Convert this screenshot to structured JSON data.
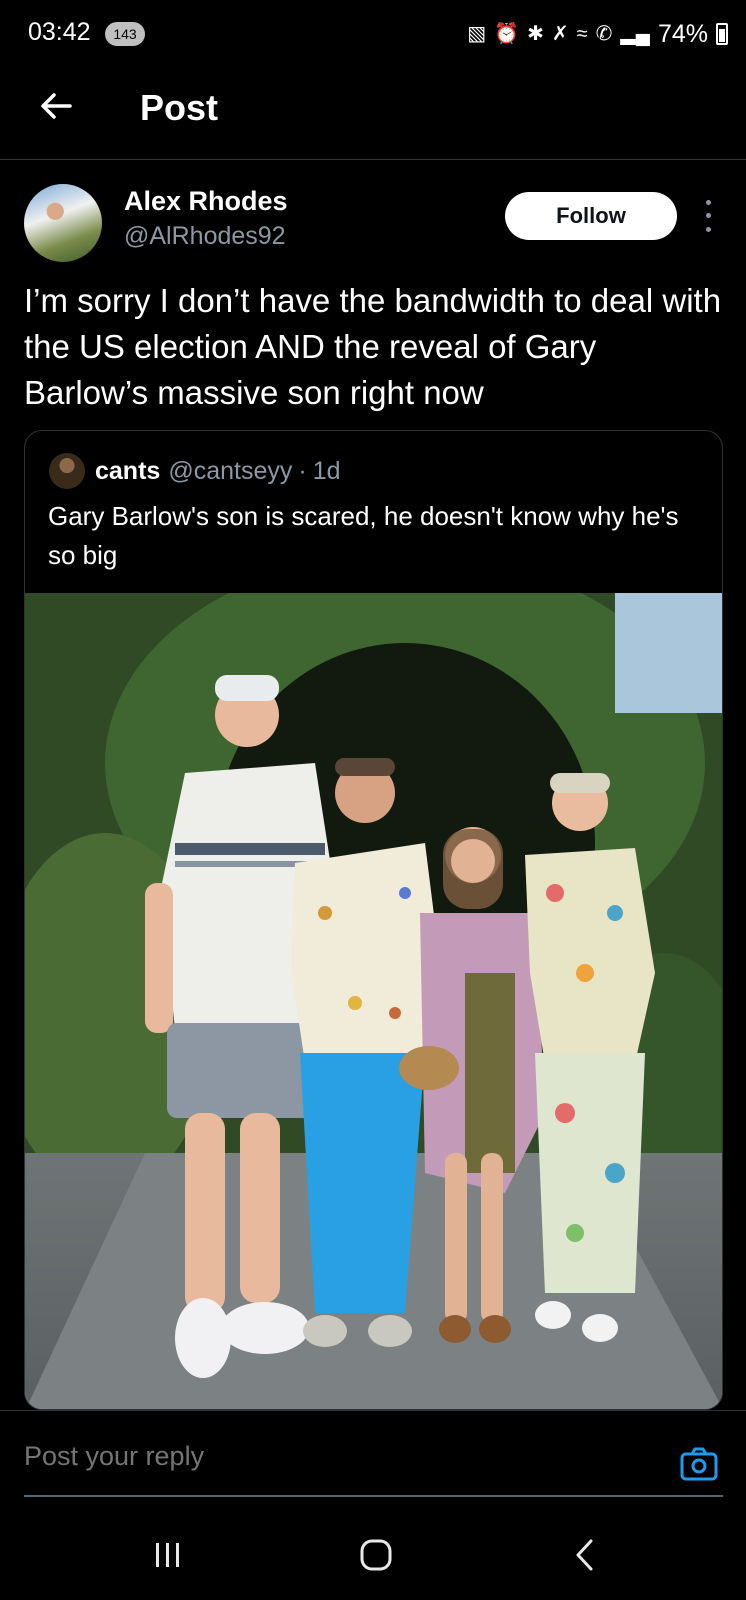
{
  "status_bar": {
    "time": "03:42",
    "notification_count": "143",
    "battery": "74%"
  },
  "header": {
    "title": "Post"
  },
  "post": {
    "author_name": "Alex Rhodes",
    "author_handle": "@AlRhodes92",
    "follow_label": "Follow",
    "text": "I’m sorry I don’t have the bandwidth to deal with the US election AND the reveal of Gary Barlow’s massive son right now"
  },
  "quoted_post": {
    "author_name": "cants",
    "author_handle": "@cantseyy",
    "separator": "·",
    "time": "1d",
    "text": "Gary Barlow's son is scared, he doesn't know why he's so big"
  },
  "reply": {
    "placeholder": "Post your reply"
  },
  "colors": {
    "background": "#000000",
    "text_primary": "#ffffff",
    "text_secondary": "#8b98a5",
    "border": "#2f3336",
    "accent": "#1d9bf0"
  }
}
